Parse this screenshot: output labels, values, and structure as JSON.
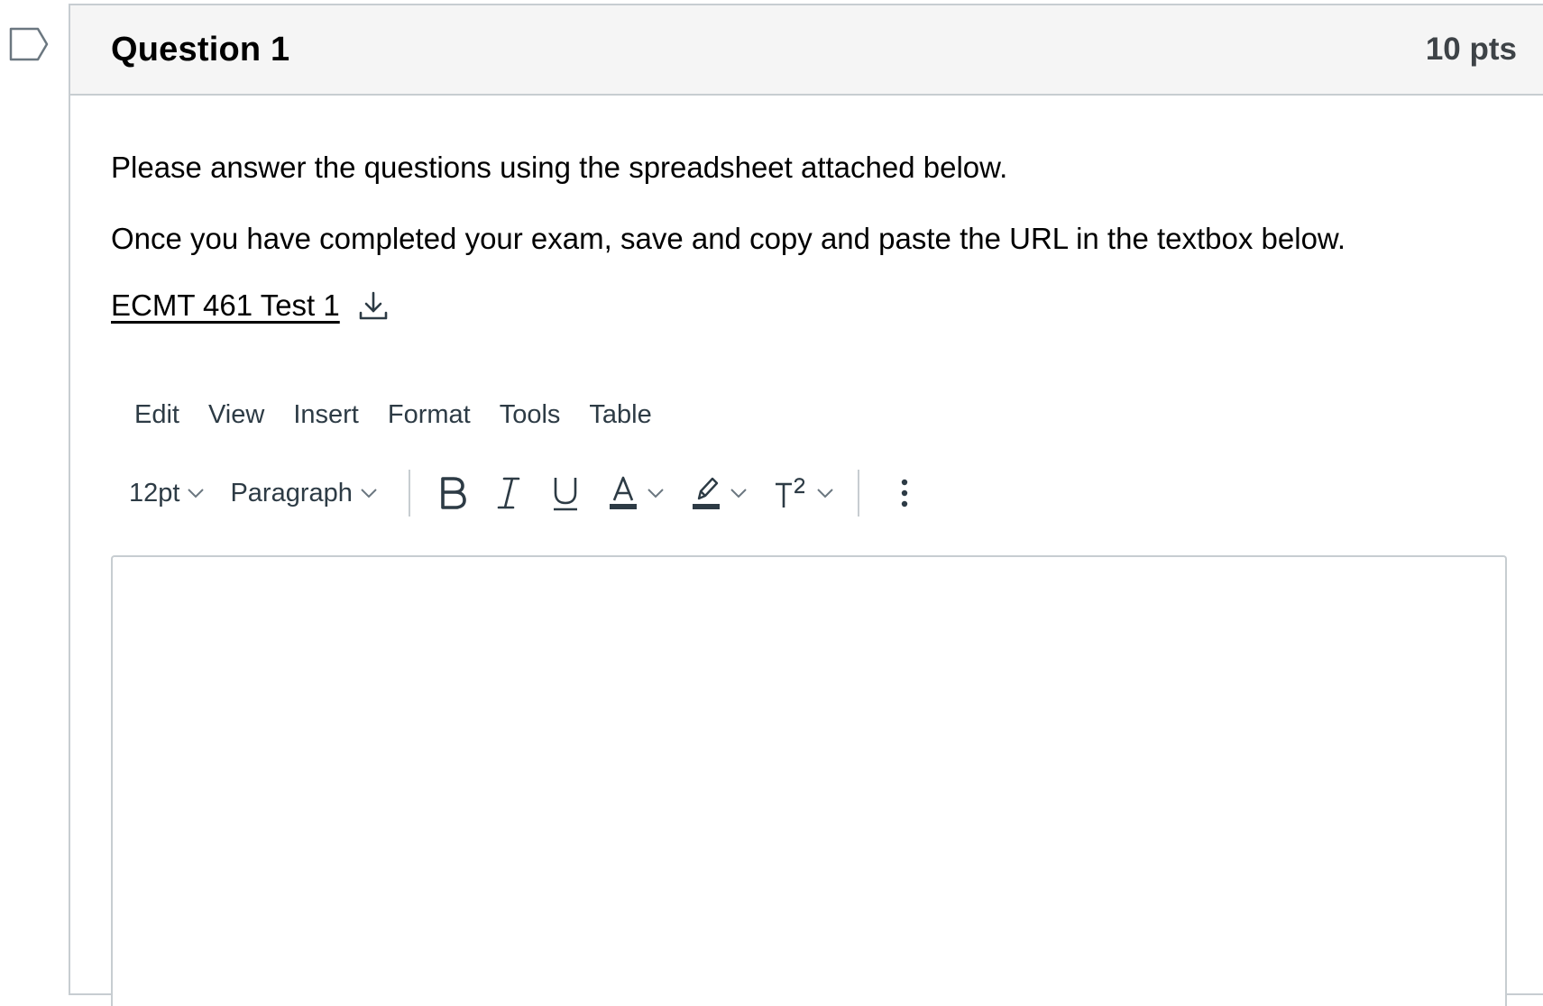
{
  "question": {
    "title": "Question 1",
    "points": "10 pts",
    "flag_icon": "flag-outline-icon",
    "paragraphs": [
      "Please answer the questions using the spreadsheet attached below.",
      "Once you have completed your exam, save and copy and paste the URL in the textbox below."
    ],
    "attachment": {
      "label": "ECMT 461 Test 1",
      "icon": "download-icon"
    }
  },
  "editor": {
    "menu": [
      "Edit",
      "View",
      "Insert",
      "Format",
      "Tools",
      "Table"
    ],
    "font_size": "12pt",
    "block_format": "Paragraph",
    "toolbar_icons": [
      "bold-icon",
      "italic-icon",
      "underline-icon",
      "text-color-icon",
      "highlight-icon",
      "superscript-icon",
      "more-options-icon"
    ],
    "content": ""
  },
  "colors": {
    "border": "#c7cdd1",
    "header_bg": "#f5f5f5",
    "text": "#2d3b45"
  }
}
